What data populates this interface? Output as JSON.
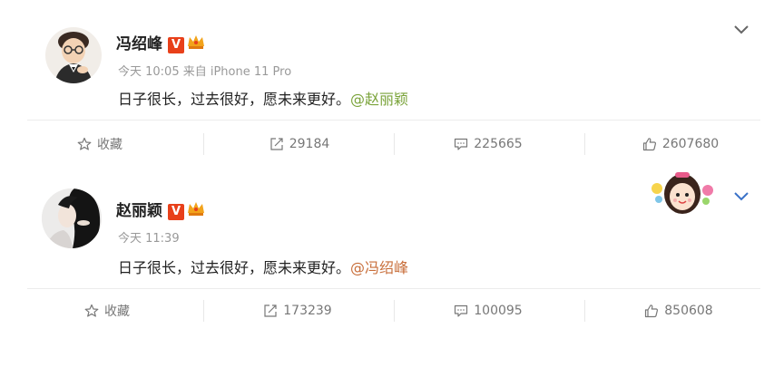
{
  "posts": [
    {
      "author": "冯绍峰",
      "meta": "今天 10:05 来自 iPhone 11 Pro",
      "text": "日子很长，过去很好，愿未来更好。",
      "mention": "@赵丽颖",
      "actions": {
        "favorite": "收藏",
        "repost": "29184",
        "comment": "225665",
        "like": "2607680"
      }
    },
    {
      "author": "赵丽颖",
      "meta": "今天 11:39",
      "text": "日子很长，过去很好，愿未来更好。",
      "mention": "@冯绍峰",
      "actions": {
        "favorite": "收藏",
        "repost": "173239",
        "comment": "100095",
        "like": "850608"
      }
    }
  ],
  "badges": {
    "verified": "V"
  },
  "colors": {
    "mention_green": "#7aa33a",
    "mention_orange": "#c86e3a",
    "verified_red": "#e8401a"
  },
  "icons": [
    "star-icon",
    "repost-icon",
    "comment-icon",
    "thumbs-up-icon",
    "chevron-down-icon",
    "crown-icon"
  ]
}
